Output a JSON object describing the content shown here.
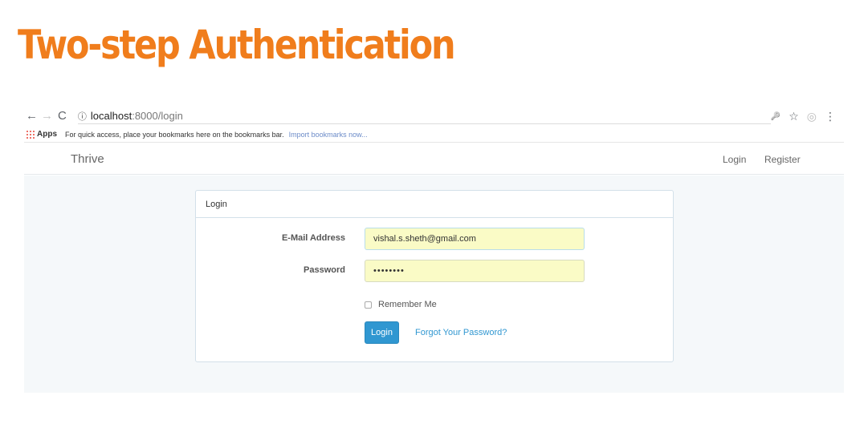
{
  "slide": {
    "title": "Two-step Authentication",
    "title_color": "#f07d1c"
  },
  "browser": {
    "back_icon": "←",
    "forward_icon": "→",
    "reload_icon": "C",
    "info_icon": "ⓘ",
    "url_host": "localhost",
    "url_rest": ":8000/login",
    "key_icon": "🔑",
    "star_icon": "☆",
    "account_icon": "◎",
    "menu_icon": "⋮",
    "bookmarks": {
      "apps_label": "Apps",
      "message": "For quick access, place your bookmarks here on the bookmarks bar.",
      "import_link": "Import bookmarks now..."
    }
  },
  "app": {
    "brand": "Thrive",
    "nav": {
      "login": "Login",
      "register": "Register"
    },
    "panel": {
      "heading": "Login",
      "email_label": "E-Mail Address",
      "email_value": "vishal.s.sheth@gmail.com",
      "password_label": "Password",
      "password_value": "••••••••",
      "remember_label": "Remember Me",
      "remember_checked": false,
      "login_button": "Login",
      "forgot_link": "Forgot Your Password?"
    },
    "colors": {
      "primary": "#3097d1",
      "autofill": "#fafbc6",
      "background": "#f5f8fa"
    }
  }
}
